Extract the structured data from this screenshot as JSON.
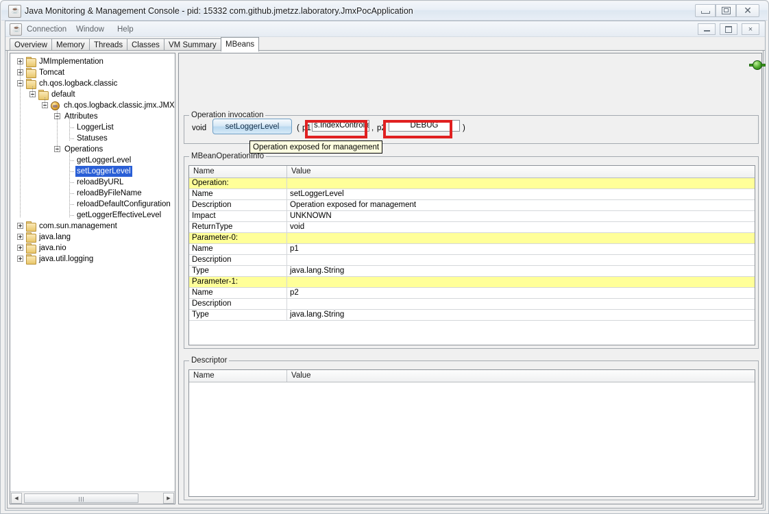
{
  "window": {
    "title": "Java Monitoring & Management Console - pid: 15332 com.github.jmetzz.laboratory.JmxPocApplication",
    "icon": "java-cup-icon",
    "buttons": {
      "minimize": "—",
      "maximize": "▣",
      "close": "✕"
    }
  },
  "inner_window": {
    "buttons": {
      "minimize": "_",
      "maximize": "▭",
      "close": "×"
    }
  },
  "menu": {
    "items": [
      {
        "label": "Connection"
      },
      {
        "label": "Window"
      },
      {
        "label": "Help"
      }
    ]
  },
  "tabs": [
    {
      "label": "Overview",
      "active": false
    },
    {
      "label": "Memory",
      "active": false
    },
    {
      "label": "Threads",
      "active": false
    },
    {
      "label": "Classes",
      "active": false
    },
    {
      "label": "VM Summary",
      "active": false
    },
    {
      "label": "MBeans",
      "active": true
    }
  ],
  "tree": {
    "nodes": [
      {
        "label": "JMImplementation",
        "depth": 0,
        "toggle": "plus",
        "icon": "folder-icon",
        "selected": false
      },
      {
        "label": "Tomcat",
        "depth": 0,
        "toggle": "plus",
        "icon": "folder-icon",
        "selected": false
      },
      {
        "label": "ch.qos.logback.classic",
        "depth": 0,
        "toggle": "minus",
        "icon": "folder-icon",
        "selected": false
      },
      {
        "label": "default",
        "depth": 1,
        "toggle": "minus",
        "icon": "folder-icon",
        "selected": false
      },
      {
        "label": "ch.qos.logback.classic.jmx.JMXCo",
        "depth": 2,
        "toggle": "minus",
        "icon": "mbean-icon",
        "selected": false
      },
      {
        "label": "Attributes",
        "depth": 3,
        "toggle": "minus",
        "icon": "none",
        "selected": false
      },
      {
        "label": "LoggerList",
        "depth": 4,
        "toggle": "none",
        "icon": "none",
        "selected": false
      },
      {
        "label": "Statuses",
        "depth": 4,
        "toggle": "none",
        "icon": "none",
        "selected": false
      },
      {
        "label": "Operations",
        "depth": 3,
        "toggle": "minus",
        "icon": "none",
        "selected": false
      },
      {
        "label": "getLoggerLevel",
        "depth": 4,
        "toggle": "none",
        "icon": "none",
        "selected": false
      },
      {
        "label": "setLoggerLevel",
        "depth": 4,
        "toggle": "none",
        "icon": "none",
        "selected": true
      },
      {
        "label": "reloadByURL",
        "depth": 4,
        "toggle": "none",
        "icon": "none",
        "selected": false
      },
      {
        "label": "reloadByFileName",
        "depth": 4,
        "toggle": "none",
        "icon": "none",
        "selected": false
      },
      {
        "label": "reloadDefaultConfiguration",
        "depth": 4,
        "toggle": "none",
        "icon": "none",
        "selected": false
      },
      {
        "label": "getLoggerEffectiveLevel",
        "depth": 4,
        "toggle": "none",
        "icon": "none",
        "selected": false
      },
      {
        "label": "com.sun.management",
        "depth": 0,
        "toggle": "plus",
        "icon": "folder-icon",
        "selected": false
      },
      {
        "label": "java.lang",
        "depth": 0,
        "toggle": "plus",
        "icon": "folder-icon",
        "selected": false
      },
      {
        "label": "java.nio",
        "depth": 0,
        "toggle": "plus",
        "icon": "folder-icon",
        "selected": false
      },
      {
        "label": "java.util.logging",
        "depth": 0,
        "toggle": "plus",
        "icon": "folder-icon",
        "selected": false
      }
    ],
    "scrollbar": {
      "left_arrow": "◀",
      "right_arrow": "▶"
    }
  },
  "invocation": {
    "group_title": "Operation invocation",
    "return_type": "void",
    "operation_button": "setLoggerLevel",
    "paren_open": "(",
    "paren_close": ")",
    "comma": ",",
    "param1": {
      "label": "p1",
      "value": "s.IndexControlle",
      "highlighted": true
    },
    "param2": {
      "label": "p2",
      "value": "DEBUG",
      "highlighted": true
    },
    "highlight_color": "#e02020"
  },
  "tooltip": {
    "text": "Operation exposed for management"
  },
  "operation_info": {
    "group_title": "MBeanOperationInfo",
    "columns": [
      "Name",
      "Value"
    ],
    "rows": [
      {
        "name": "Operation:",
        "value": "",
        "section": true
      },
      {
        "name": "Name",
        "value": "setLoggerLevel",
        "section": false
      },
      {
        "name": "Description",
        "value": "Operation exposed for management",
        "section": false
      },
      {
        "name": "Impact",
        "value": "UNKNOWN",
        "section": false
      },
      {
        "name": "ReturnType",
        "value": "void",
        "section": false
      },
      {
        "name": "Parameter-0:",
        "value": "",
        "section": true
      },
      {
        "name": "Name",
        "value": "p1",
        "section": false
      },
      {
        "name": "Description",
        "value": "",
        "section": false
      },
      {
        "name": "Type",
        "value": "java.lang.String",
        "section": false
      },
      {
        "name": "Parameter-1:",
        "value": "",
        "section": true
      },
      {
        "name": "Name",
        "value": "p2",
        "section": false
      },
      {
        "name": "Description",
        "value": "",
        "section": false
      },
      {
        "name": "Type",
        "value": "java.lang.String",
        "section": false
      }
    ],
    "section_color": "#ffff99"
  },
  "descriptor": {
    "group_title": "Descriptor",
    "columns": [
      "Name",
      "Value"
    ],
    "rows": []
  },
  "status": {
    "connection_indicator": "connected-green-icon"
  }
}
